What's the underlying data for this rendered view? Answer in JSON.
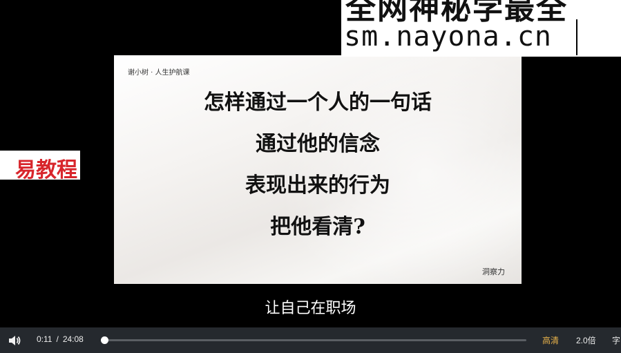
{
  "watermark": {
    "line1": "全网神秘学最全",
    "line2": "sm.nayona.cn"
  },
  "side_banner": {
    "text": "易教程"
  },
  "slide": {
    "tag": "谢小树 · 人生护航课",
    "lines": [
      "怎样通过一个人的一句话",
      "通过他的信念",
      "表现出来的行为",
      "把他看清?"
    ],
    "corner_mark": "洞察力"
  },
  "subtitle": "让自己在职场",
  "player": {
    "current_time": "0:11",
    "separator": "/",
    "duration": "24:08",
    "progress_fraction": 0.0076,
    "quality": "高清",
    "speed": "2.0倍",
    "caption_button": "字",
    "colors": {
      "quality": "#e8b24b",
      "bar_bg": "#25292e"
    },
    "volume_icon": "volume-icon"
  }
}
